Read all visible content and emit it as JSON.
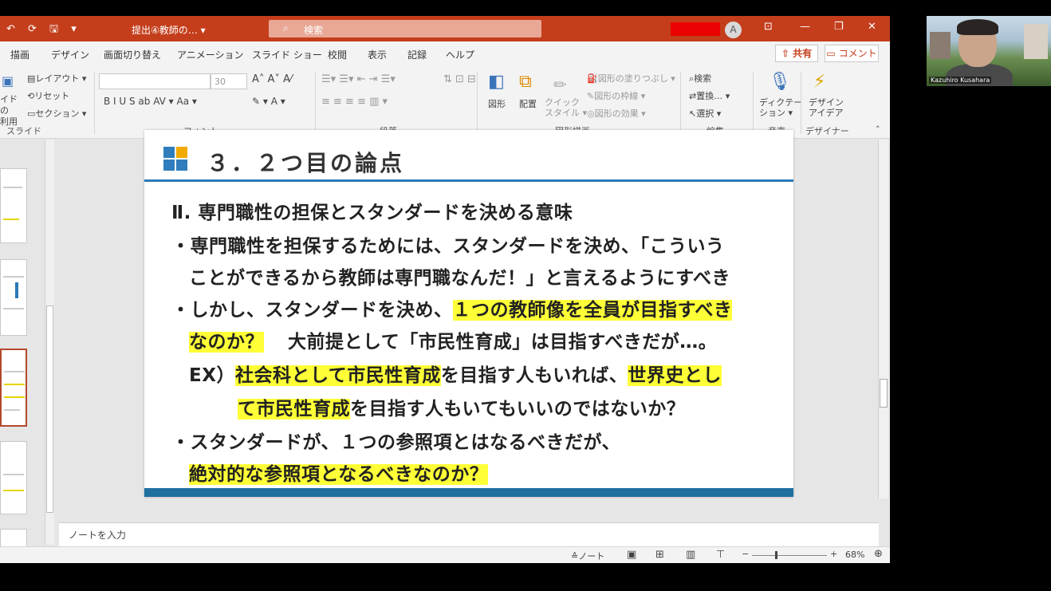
{
  "titlebar": {
    "quick_access": "↶ ⟳ 🖫 ▾",
    "document_title": "提出④教師の… ▾",
    "search_placeholder": "検索",
    "account_initial": "A",
    "window_buttons": [
      "⊡",
      "—",
      "❐",
      "✕"
    ]
  },
  "tabs": [
    "描画",
    "デザイン",
    "画面切り替え",
    "アニメーション",
    "スライド ショー",
    "校閲",
    "表示",
    "記録",
    "ヘルプ"
  ],
  "share_label": "共有",
  "comment_label": "コメント",
  "ribbon": {
    "slides": {
      "reuse_label": "イドの\n利用",
      "layout": "レイアウト ▾",
      "reset": "リセット",
      "section": "セクション ▾",
      "group": "スライド"
    },
    "font": {
      "size": "30",
      "group": "フォント",
      "buttons": "B  I  U  S  ab  AV ▾  Aa ▾"
    },
    "paragraph": {
      "group": "段落"
    },
    "drawing": {
      "shape": "図形",
      "arrange": "配置",
      "quick_style": "クイック\nスタイル ▾",
      "fill": "図形の塗りつぶし ▾",
      "outline": "図形の枠線 ▾",
      "effect": "図形の効果 ▾",
      "group": "図形描画"
    },
    "editing": {
      "find": "検索",
      "replace": "置換… ▾",
      "select": "選択 ▾",
      "group": "編集"
    },
    "voice": {
      "dictate": "ディクテー\nション ▾",
      "group": "音声"
    },
    "designer": {
      "ideas": "デザイン\nアイデア",
      "group": "デザイナー"
    }
  },
  "slide": {
    "title": "３．２つ目の論点",
    "heading": "Ⅱ. 専門職性の担保とスタンダードを決める意味",
    "b1_line1": "・専門職性を担保するためには、スタンダードを決め、「こういう",
    "b1_line2": "ことができるから教師は専門職なんだ！」と言えるようにすべき",
    "b2_line1_plain": "・しかし、スタンダードを決め、",
    "b2_line1_hl": "１つの教師像を全員が目指すべき",
    "b2_line2_hl": "なのか？",
    "b2_line2_plain": "大前提として「市民性育成」は目指すべきだが…。",
    "ex_prefix": "EX）",
    "ex_hl1": "社会科として市民性育成",
    "ex_mid": "を目指す人もいれば、",
    "ex_hl2": "世界史とし",
    "ex2_hl": "て市民性育成",
    "ex2_plain": "を目指す人もいてもいいのではないか？",
    "b3_line1": "・スタンダードが、１つの参照項とはなるべきだが、",
    "b3_line2_hl": "絶対的な参照項となるべきなのか？"
  },
  "notes_placeholder": "ノートを入力",
  "status": {
    "notes_btn": "≙ノート",
    "zoom": "68%"
  },
  "webcam": {
    "name": "Kazuhiro Kusahara"
  }
}
